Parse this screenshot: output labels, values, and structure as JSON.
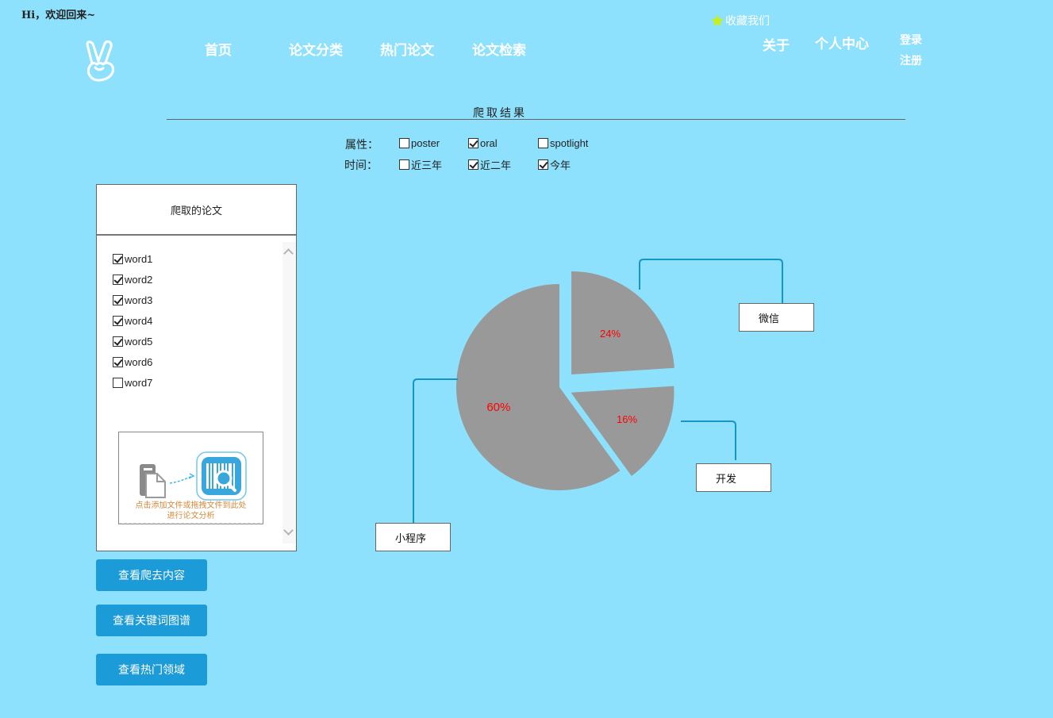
{
  "header": {
    "greeting": "Hi，欢迎回来~",
    "favorite": "收藏我们",
    "nav": [
      "首页",
      "论文分类",
      "热门论文",
      "论文检索"
    ],
    "about": "关于",
    "profile": "个人中心",
    "login": "登录",
    "register": "注册"
  },
  "section_title": "爬取结果",
  "filters": {
    "attribute_label": "属性：",
    "attribute_options": [
      {
        "label": "poster",
        "checked": false
      },
      {
        "label": "oral",
        "checked": true
      },
      {
        "label": "spotlight",
        "checked": false
      }
    ],
    "time_label": "时间：",
    "time_options": [
      {
        "label": "近三年",
        "checked": false
      },
      {
        "label": "近二年",
        "checked": true
      },
      {
        "label": "今年",
        "checked": true
      }
    ]
  },
  "panel": {
    "title": "爬取的论文",
    "words": [
      {
        "label": "word1",
        "checked": true
      },
      {
        "label": "word2",
        "checked": true
      },
      {
        "label": "word3",
        "checked": true
      },
      {
        "label": "word4",
        "checked": true
      },
      {
        "label": "word5",
        "checked": true
      },
      {
        "label": "word6",
        "checked": true
      },
      {
        "label": "word7",
        "checked": false
      }
    ],
    "upload_line1": "点击添加文件或拖拽文件到此处",
    "upload_line2": "进行论文分析"
  },
  "buttons": {
    "view_content": "查看爬去内容",
    "view_keywords": "查看关键词图谱",
    "view_hot": "查看热门领域"
  },
  "chart_data": {
    "type": "pie",
    "slices": [
      {
        "name": "微信",
        "value": 24,
        "label": "24%"
      },
      {
        "name": "开发",
        "value": 16,
        "label": "16%"
      },
      {
        "name": "小程序",
        "value": 60,
        "label": "60%"
      }
    ],
    "slice_color": "#999999",
    "label_color": "#ff0000",
    "leader_color": "#1796c6"
  },
  "colors": {
    "background": "#8ee1fc",
    "button": "#1b9bd7",
    "star": "#c6f01a"
  }
}
